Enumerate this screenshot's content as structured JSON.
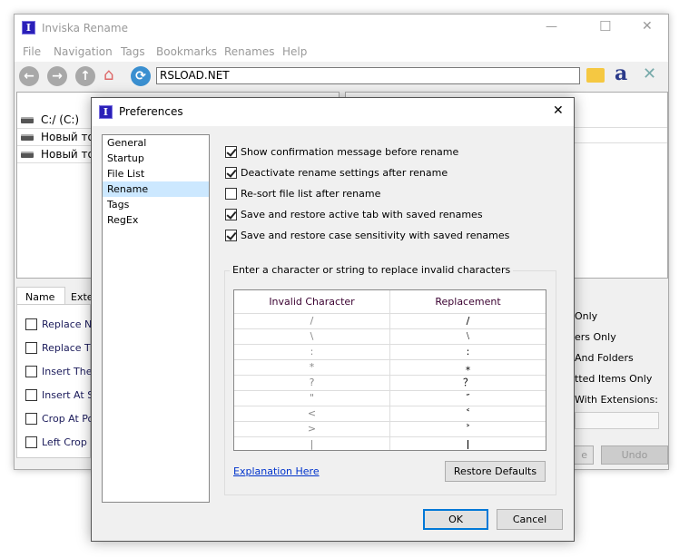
{
  "main": {
    "title": "Inviska Rename",
    "window_controls": {
      "minimize": "—",
      "maximize": "☐",
      "close": "✕"
    },
    "menu": [
      "File",
      "Navigation",
      "Tags",
      "Bookmarks",
      "Renames",
      "Help"
    ],
    "address": "RSLOAD.NET",
    "drives": [
      "C:/ (C:)",
      "Новый том",
      "Новый том"
    ],
    "tabs": [
      "Name",
      "Exte"
    ],
    "options": [
      "Replace Nar",
      "Replace The",
      "Insert The T",
      "Insert At St",
      "Crop At Pos",
      "Left Crop N"
    ],
    "right_options": [
      "Only",
      "ers Only",
      "And Folders",
      "tted Items Only",
      "With Extensions:"
    ],
    "buttons": {
      "rename": "e",
      "undo": "Undo"
    }
  },
  "dialog": {
    "title": "Preferences",
    "close": "✕",
    "categories": [
      "General",
      "Startup",
      "File List",
      "Rename",
      "Tags",
      "RegEx"
    ],
    "selected_category": "Rename",
    "checkboxes": [
      {
        "label": "Show confirmation message before rename",
        "checked": true
      },
      {
        "label": "Deactivate rename settings after rename",
        "checked": true
      },
      {
        "label": "Re-sort file list after rename",
        "checked": false
      },
      {
        "label": "Save and restore active tab with saved renames",
        "checked": true
      },
      {
        "label": "Save and restore case sensitivity with saved renames",
        "checked": true
      }
    ],
    "group_title": "Enter a character or string to replace invalid characters",
    "table": {
      "headers": [
        "Invalid Character",
        "Replacement"
      ],
      "rows": [
        [
          "/",
          "∕"
        ],
        [
          "\\",
          "⧵"
        ],
        [
          ":",
          "꞉"
        ],
        [
          "*",
          "⁎"
        ],
        [
          "?",
          "？"
        ],
        [
          "\"",
          "″"
        ],
        [
          "<",
          "˂"
        ],
        [
          ">",
          "˃"
        ],
        [
          "|",
          "ǀ"
        ]
      ]
    },
    "link": "Explanation Here",
    "restore_defaults": "Restore Defaults",
    "ok": "OK",
    "cancel": "Cancel"
  }
}
